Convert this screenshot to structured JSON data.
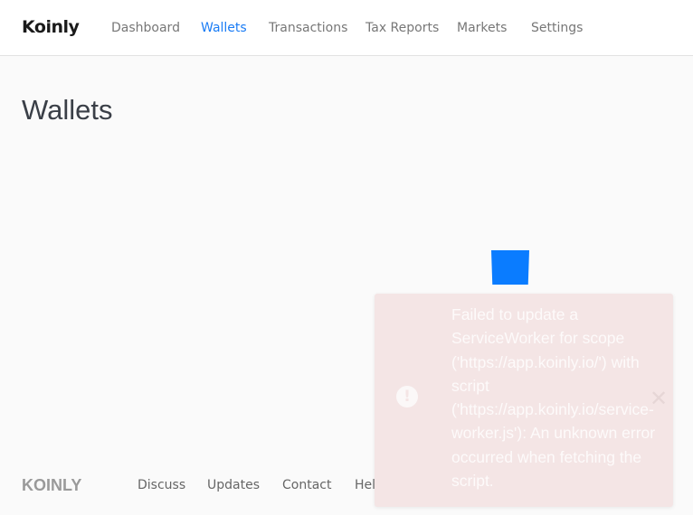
{
  "header": {
    "logo": "Koinly",
    "nav": [
      {
        "label": "Dashboard"
      },
      {
        "label": "Wallets",
        "active": true
      },
      {
        "label": "Transactions"
      },
      {
        "label": "Tax Reports"
      },
      {
        "label": "Markets"
      },
      {
        "label": "Settings"
      }
    ]
  },
  "page": {
    "title": "Wallets"
  },
  "footer": {
    "logo": "KOINLY",
    "links": [
      "Discuss",
      "Updates",
      "Contact",
      "Help"
    ]
  },
  "toast": {
    "icon": "exclamation-circle-icon",
    "message": "Failed to update a ServiceWorker for scope ('https://app.koinly.io/') with script ('https://app.koinly.io/service-worker.js'): An unknown error occurred when fetching the script.",
    "close_icon": "close-icon"
  },
  "colors": {
    "accent": "#1a7cf5",
    "loader": "#0a7cff",
    "toast_bg": "#f4e5e5"
  }
}
